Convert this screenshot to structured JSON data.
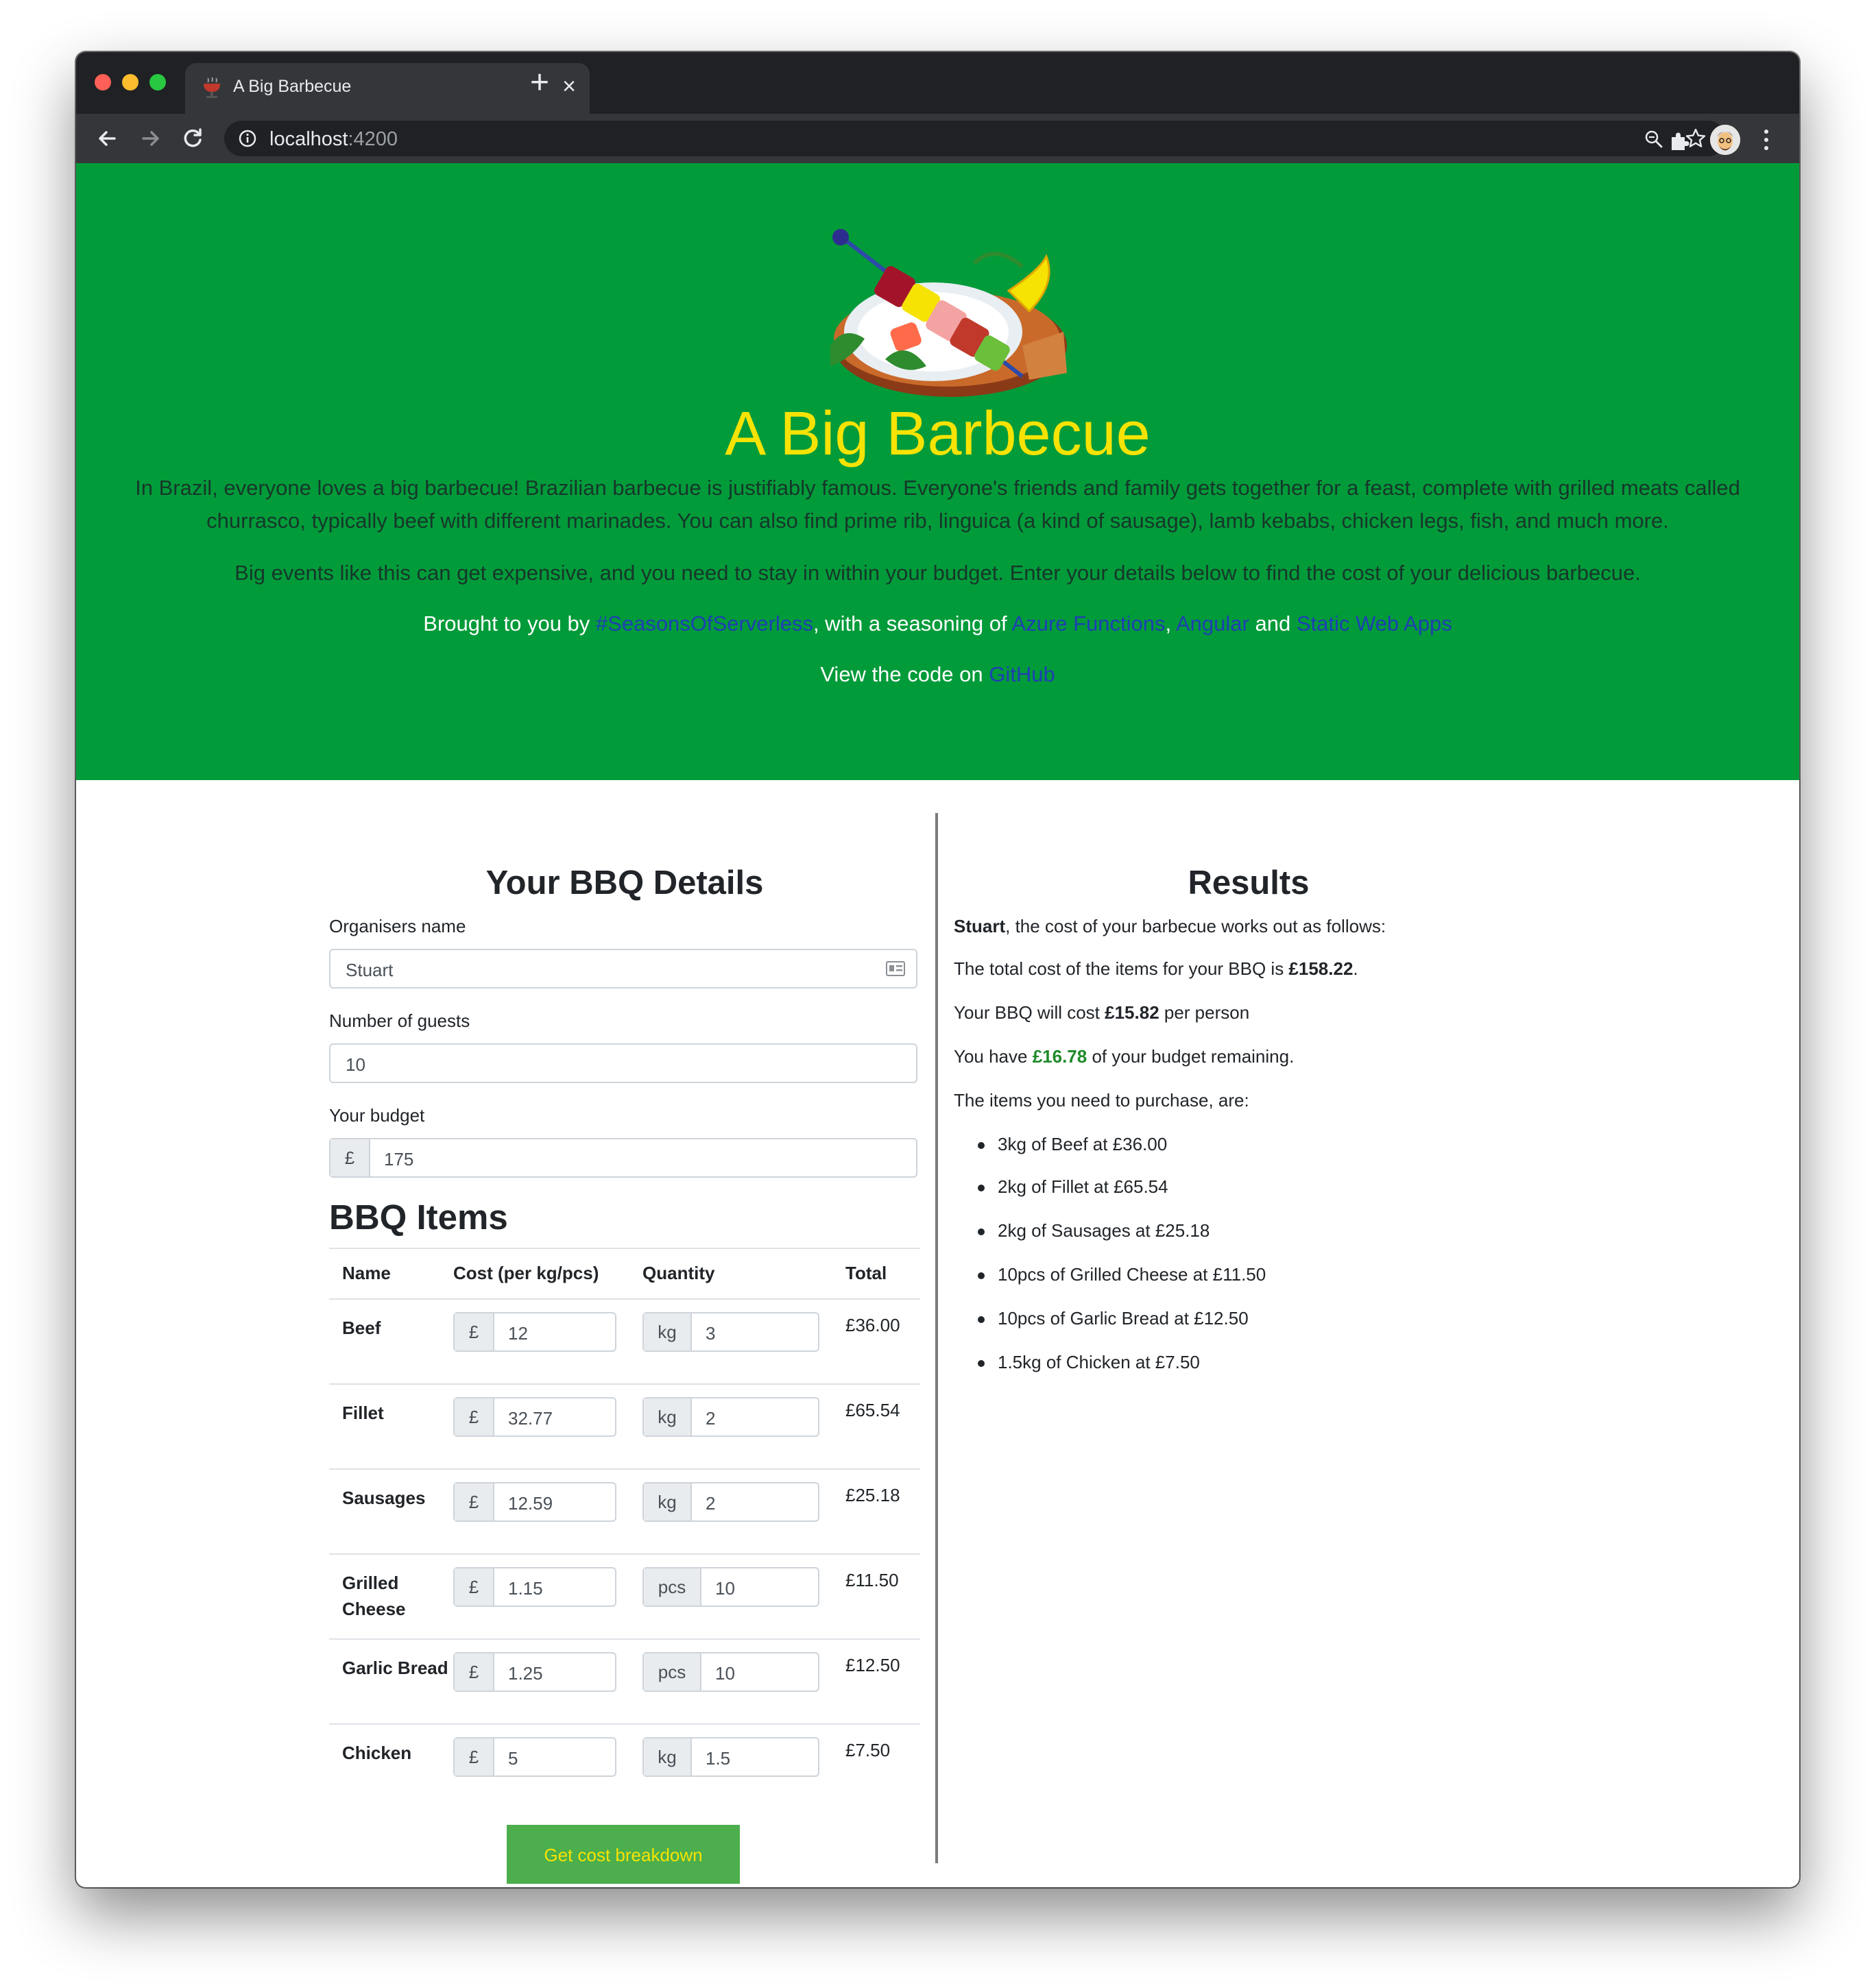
{
  "browser": {
    "tab_title": "A Big Barbecue",
    "url_host": "localhost",
    "url_port": ":4200"
  },
  "hero": {
    "title": "A Big Barbecue",
    "intro": "In Brazil, everyone loves a big barbecue! Brazilian barbecue is justifiably famous. Everyone's friends and family gets together for a feast, complete with grilled meats called churrasco, typically beef with different marinades. You can also find prime rib, linguica (a kind of sausage), lamb kebabs, chicken legs, fish, and much more.",
    "budget_note": "Big events like this can get expensive, and you need to stay in within your budget. Enter your details below to find the cost of your delicious barbecue.",
    "brought_prefix": "Brought to you by ",
    "brought_link1": "#SeasonsOfServerless",
    "brought_mid": ", with a seasoning of ",
    "brought_link2": "Azure Functions",
    "brought_sep": ", ",
    "brought_link3": "Angular",
    "brought_and": " and ",
    "brought_link4": "Static Web Apps",
    "code_prefix": "View the code on ",
    "code_link": "GitHub"
  },
  "details": {
    "title": "Your BBQ Details",
    "organiser_label": "Organisers name",
    "organiser_value": "Stuart",
    "guests_label": "Number of guests",
    "guests_value": "10",
    "budget_label": "Your budget",
    "budget_currency": "£",
    "budget_value": "175"
  },
  "items": {
    "title": "BBQ Items",
    "headers": [
      "Name",
      "Cost (per kg/pcs)",
      "Quantity",
      "Total"
    ],
    "rows": [
      {
        "name": "Beef",
        "currency": "£",
        "cost": "12",
        "unit": "kg",
        "qty": "3",
        "total": "£36.00"
      },
      {
        "name": "Fillet",
        "currency": "£",
        "cost": "32.77",
        "unit": "kg",
        "qty": "2",
        "total": "£65.54"
      },
      {
        "name": "Sausages",
        "currency": "£",
        "cost": "12.59",
        "unit": "kg",
        "qty": "2",
        "total": "£25.18"
      },
      {
        "name": "Grilled Cheese",
        "currency": "£",
        "cost": "1.15",
        "unit": "pcs",
        "qty": "10",
        "total": "£11.50"
      },
      {
        "name": "Garlic Bread",
        "currency": "£",
        "cost": "1.25",
        "unit": "pcs",
        "qty": "10",
        "total": "£12.50"
      },
      {
        "name": "Chicken",
        "currency": "£",
        "cost": "5",
        "unit": "kg",
        "qty": "1.5",
        "total": "£7.50"
      }
    ],
    "button_label": "Get cost breakdown"
  },
  "results": {
    "title": "Results",
    "name": "Stuart",
    "intro_suffix": ", the cost of your barbecue works out as follows:",
    "total_prefix": "The total cost of the items for your BBQ is ",
    "total_value": "£158.22",
    "total_suffix": ".",
    "per_person_prefix": "Your BBQ will cost ",
    "per_person_value": "£15.82",
    "per_person_suffix": " per person",
    "remaining_prefix": "You have ",
    "remaining_value": "£16.78",
    "remaining_suffix": " of your budget remaining.",
    "purchase_intro": "The items you need to purchase, are:",
    "purchase_items": [
      "3kg of Beef at £36.00",
      "2kg of Fillet at £65.54",
      "2kg of Sausages at £25.18",
      "10pcs of Grilled Cheese at £11.50",
      "10pcs of Garlic Bread at £12.50",
      "1.5kg of Chicken at £7.50"
    ]
  },
  "colors": {
    "hero_bg": "#029b3a",
    "title_yellow": "#f6e304",
    "link_blue": "#1f3fb3",
    "button_green": "#4cae4c",
    "remaining_green": "#1f8a2a"
  }
}
